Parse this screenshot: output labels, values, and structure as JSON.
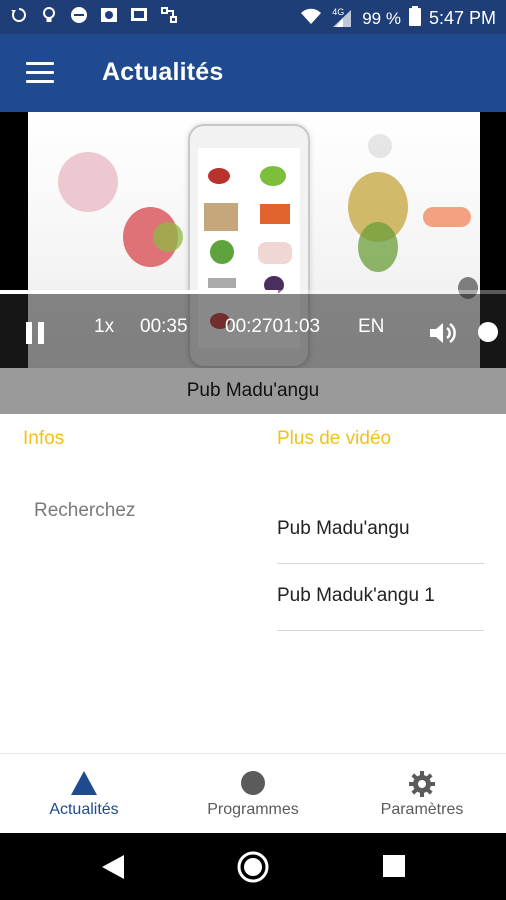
{
  "statusbar": {
    "battery": "99 %",
    "time": "5:47 PM",
    "network": "4G",
    "left_icons": [
      "sync-icon",
      "lightbulb-icon",
      "minus-circle-icon",
      "image-icon",
      "cast-icon",
      "usb-icon"
    ],
    "right_icons": [
      "wifi-icon",
      "cell-signal-icon",
      "battery-icon"
    ]
  },
  "appbar": {
    "title": "Actualités",
    "menu_icon": "hamburger-menu-icon",
    "color": "#1f4a8f"
  },
  "player": {
    "speed": "1x",
    "current_time": "00:35",
    "duration": "00:2701:03",
    "language": "EN",
    "progress": 0.55
  },
  "video": {
    "title": "Pub Madu'angu"
  },
  "sections": {
    "infos_title": "Infos",
    "more_title": "Plus de vidéo",
    "accent_color": "#f2c118"
  },
  "infos": {
    "search_label": "Recherchez"
  },
  "more_videos": [
    {
      "title": "Pub Madu'angu"
    },
    {
      "title": "Pub Maduk'angu 1"
    }
  ],
  "bottom_nav": {
    "items": [
      {
        "label": "Actualités",
        "icon": "triangle-icon",
        "active": true
      },
      {
        "label": "Programmes",
        "icon": "circle-icon",
        "active": false
      },
      {
        "label": "Paramètres",
        "icon": "gear-icon",
        "active": false
      }
    ]
  },
  "system_nav": [
    "back-icon",
    "home-icon",
    "recents-icon"
  ]
}
